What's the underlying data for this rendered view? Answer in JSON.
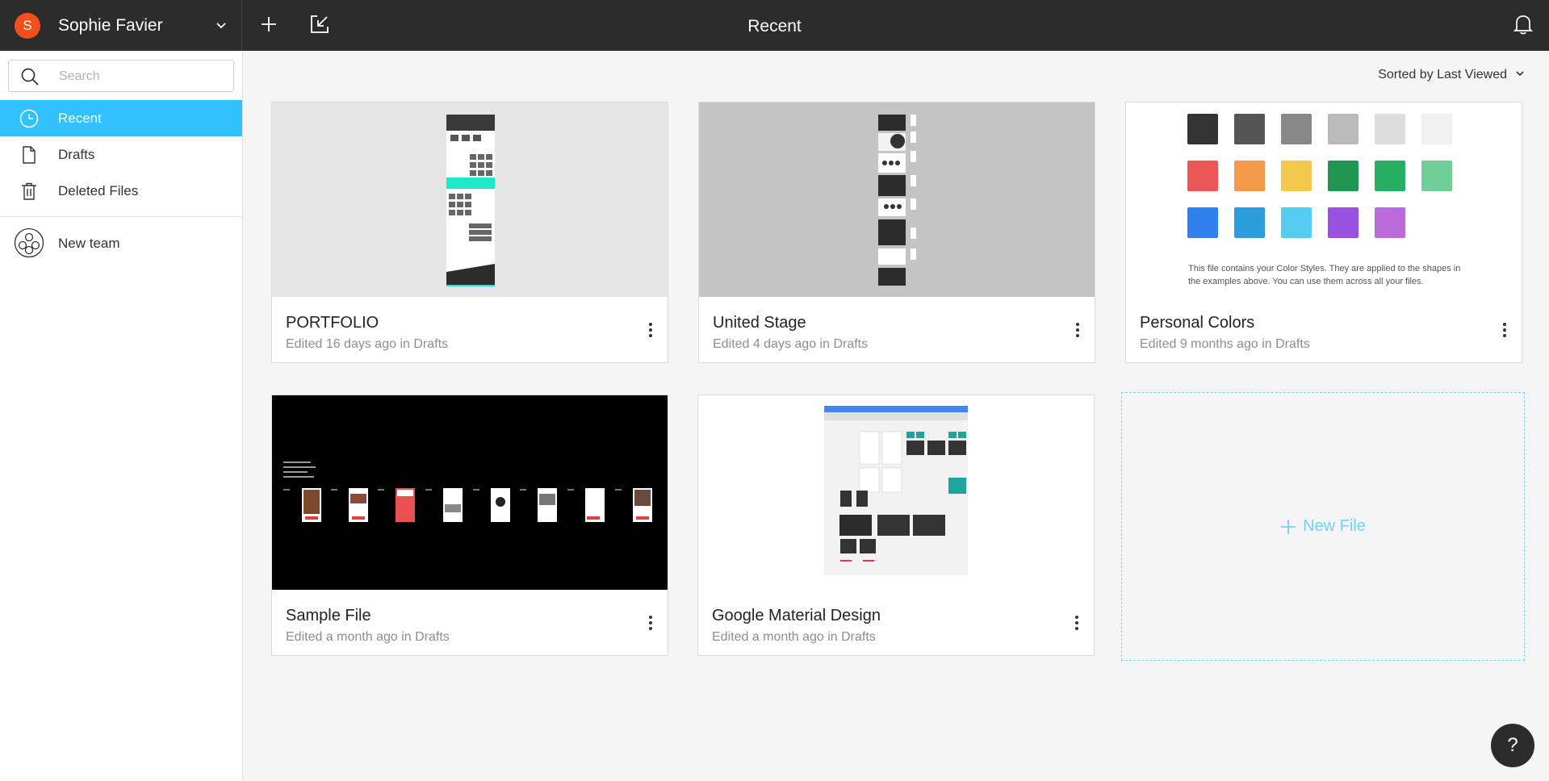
{
  "user": {
    "initial": "S",
    "name": "Sophie Favier"
  },
  "header": {
    "title": "Recent"
  },
  "sidebar": {
    "search_placeholder": "Search",
    "items": [
      {
        "label": "Recent",
        "icon": "clock-icon",
        "active": true
      },
      {
        "label": "Drafts",
        "icon": "document-icon",
        "active": false
      },
      {
        "label": "Deleted Files",
        "icon": "trash-icon",
        "active": false
      }
    ],
    "team": {
      "label": "New team",
      "icon": "team-icon"
    }
  },
  "sort": {
    "label": "Sorted by Last Viewed"
  },
  "files": [
    {
      "title": "PORTFOLIO",
      "meta": "Edited 16 days ago in Drafts"
    },
    {
      "title": "United Stage",
      "meta": "Edited 4 days ago in Drafts"
    },
    {
      "title": "Personal Colors",
      "meta": "Edited 9 months ago in Drafts",
      "note": "This file contains your Color Styles. They are applied to the shapes in the examples above. You can use them across all your files.",
      "swatches": [
        "#333333",
        "#555555",
        "#888888",
        "#bbbbbb",
        "#dddddd",
        "#f1f1f1",
        "#eb5757",
        "#f2994a",
        "#f2c94c",
        "#219653",
        "#27ae60",
        "#6fcf97",
        "#2f80ed",
        "#2d9cdb",
        "#56ccf2",
        "#9b51e0",
        "#bb6bd9"
      ]
    },
    {
      "title": "Sample File",
      "meta": "Edited a month ago in Drafts"
    },
    {
      "title": "Google Material Design",
      "meta": "Edited a month ago in Drafts"
    }
  ],
  "new_file": {
    "label": "New File"
  },
  "help": {
    "label": "?"
  },
  "colors": {
    "accent": "#30c2ff",
    "topbar": "#2c2c2c",
    "avatar": "#f24e1e"
  }
}
